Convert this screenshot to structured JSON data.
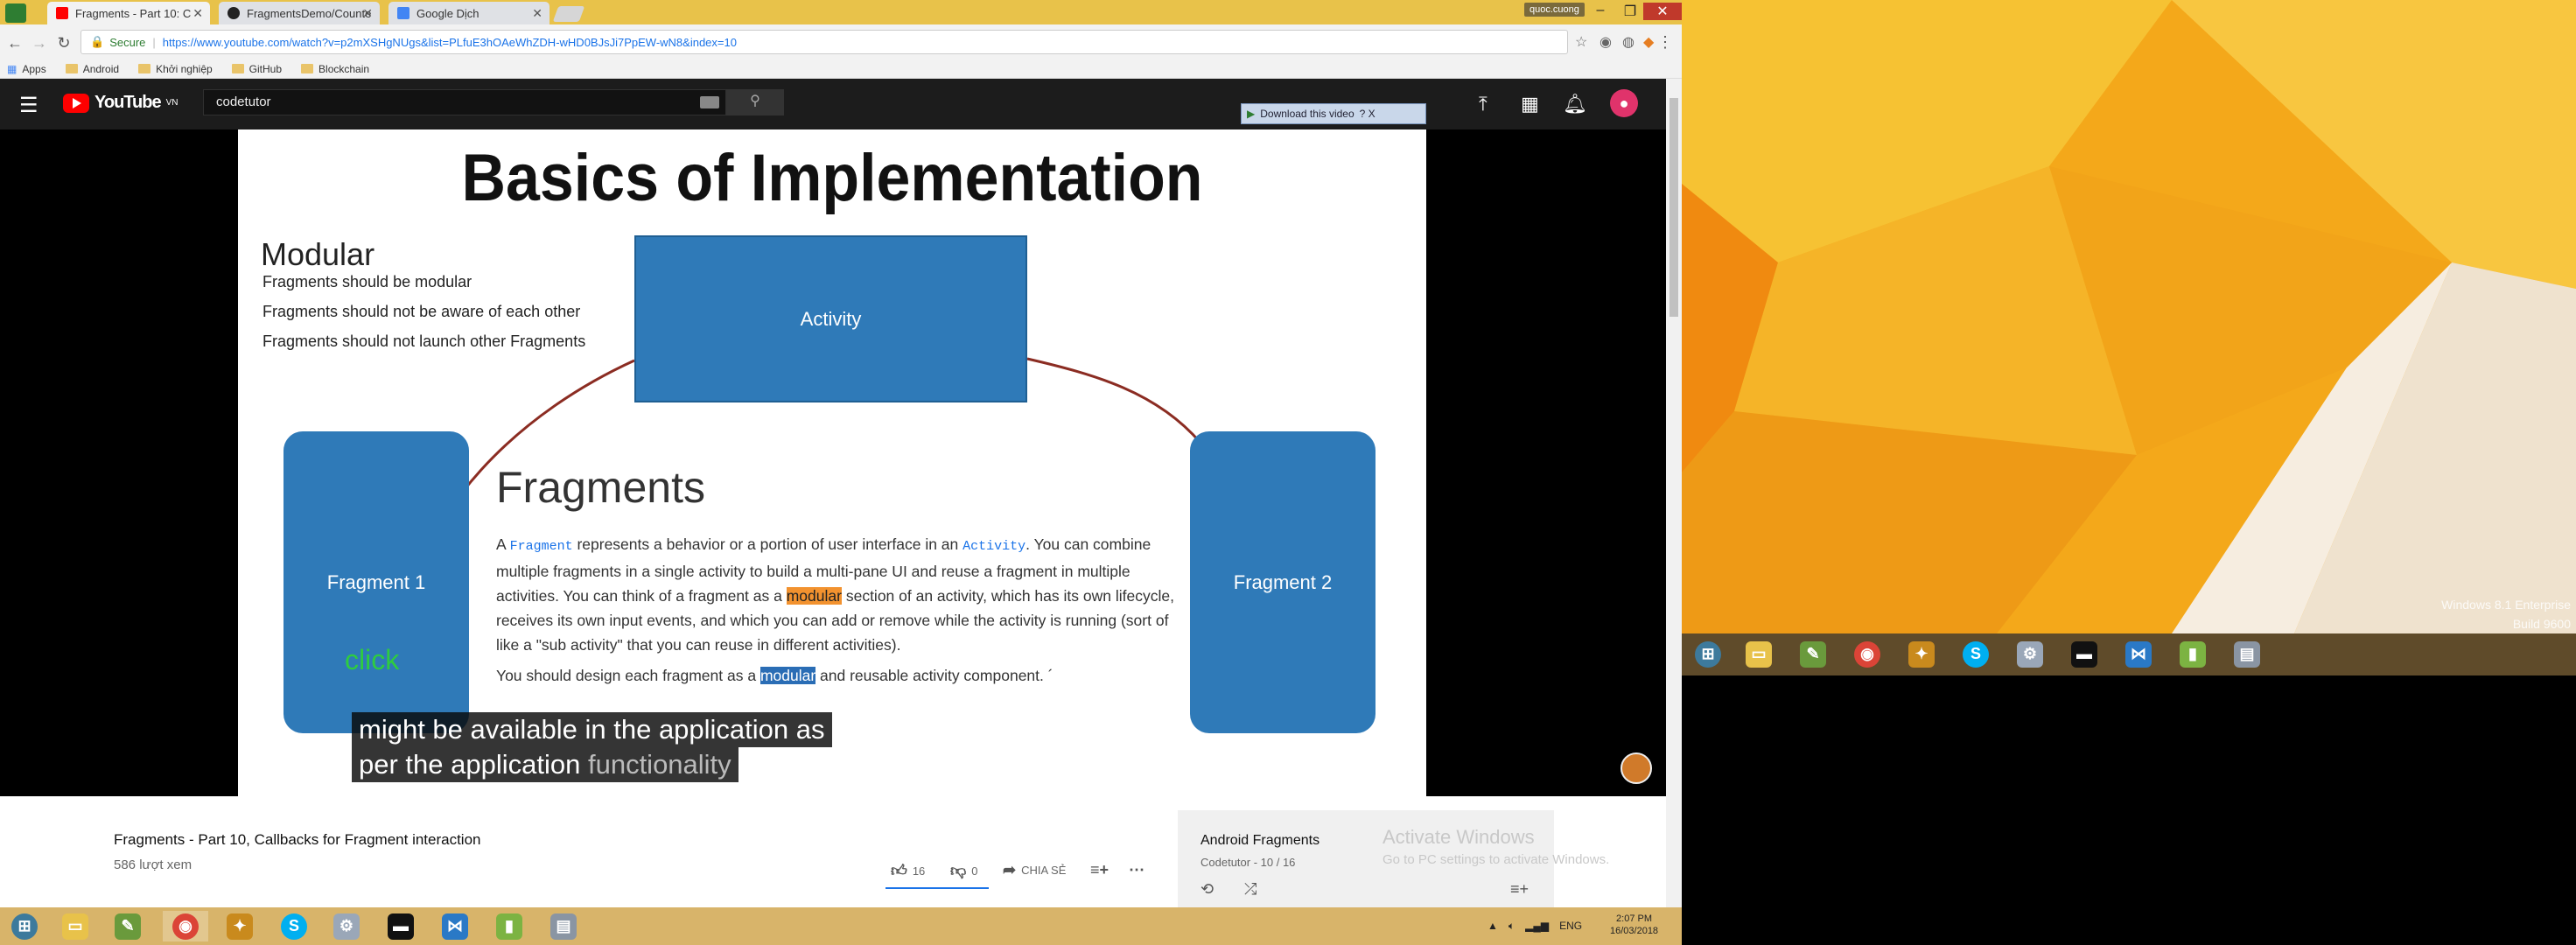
{
  "browser": {
    "tabs": [
      {
        "label": "Fragments - Part 10: C",
        "active": true
      },
      {
        "label": "FragmentsDemo/Counte",
        "active": false
      },
      {
        "label": "Google Dịch",
        "active": false
      }
    ],
    "profile_badge": "quoc.cuong",
    "omnibox": {
      "secure_label": "Secure",
      "url": "https://www.youtube.com/watch?v=p2mXSHgNUgs&list=PLfuE3hOAeWhZDH-wHD0BJsJi7PpEW-wN8&index=10"
    },
    "bookmarks": [
      "Apps",
      "Android",
      "Khởi nghiệp",
      "GitHub",
      "Blockchain"
    ]
  },
  "youtube": {
    "logo_text": "YouTube",
    "logo_region": "VN",
    "search_value": "codetutor",
    "download_label": "Download this video",
    "download_extra": "?  X"
  },
  "slide": {
    "title": "Basics of Implementation",
    "modular_heading": "Modular",
    "modular_lines": [
      "Fragments should be modular",
      "Fragments should not be aware of each other",
      "Fragments should not launch other Fragments"
    ],
    "activity_box": "Activity",
    "fragment1_box": "Fragment 1",
    "fragment2_box": "Fragment 2",
    "click_label": "click",
    "fragments_heading": "Fragments",
    "para": {
      "p1": "A ",
      "code1": "Fragment",
      "p2": " represents a behavior or a portion of user interface in an ",
      "code2": "Activity",
      "p3": ". You can combine multiple fragments in a single activity to build a multi-pane UI and reuse a fragment in multiple activities. You can think of a fragment as a ",
      "hl1": "modular",
      "p4": " section of an activity, which has its own lifecycle, receives its own input events, and which you can add or remove while the activity is running (sort of like a \"sub activity\" that you can reuse in different activities)."
    },
    "para2": {
      "p1": "You should design each fragment as a ",
      "hl": "modular",
      "p2": " and reusable activity component. ´"
    },
    "caption_line1": "might be available in the application as",
    "caption_line2_a": "per the application ",
    "caption_line2_b": "functionality"
  },
  "video_info": {
    "title": "Fragments - Part 10, Callbacks for Fragment interaction",
    "views": "586 lượt xem",
    "likes": "16",
    "dislikes": "0",
    "share": "CHIA SẺ"
  },
  "playlist": {
    "title": "Android Fragments",
    "subtitle": "Codetutor - 10 / 16"
  },
  "activation": {
    "line1": "Activate Windows",
    "line2": "Go to PC settings to activate Windows."
  },
  "taskbar_left": {
    "time": "2:07 PM",
    "date": "16/03/2018",
    "lang": "ENG"
  },
  "desktop_right": {
    "line1": "Windows 8.1 Enterprise",
    "line2": "Build 9600"
  },
  "taskbar_apps": [
    "start-icon",
    "explorer-icon",
    "notepad-icon",
    "chrome-icon",
    "paint-icon",
    "skype-icon",
    "tool-icon",
    "cmd-icon",
    "vscode-icon",
    "android-icon",
    "desktop-icon"
  ],
  "colors": {
    "accent_red": "#ff0000",
    "slide_blue": "#2f7ab8",
    "highlight_orange": "#f2922f",
    "highlight_blue": "#2a6db5",
    "click_green": "#2ecc40"
  }
}
